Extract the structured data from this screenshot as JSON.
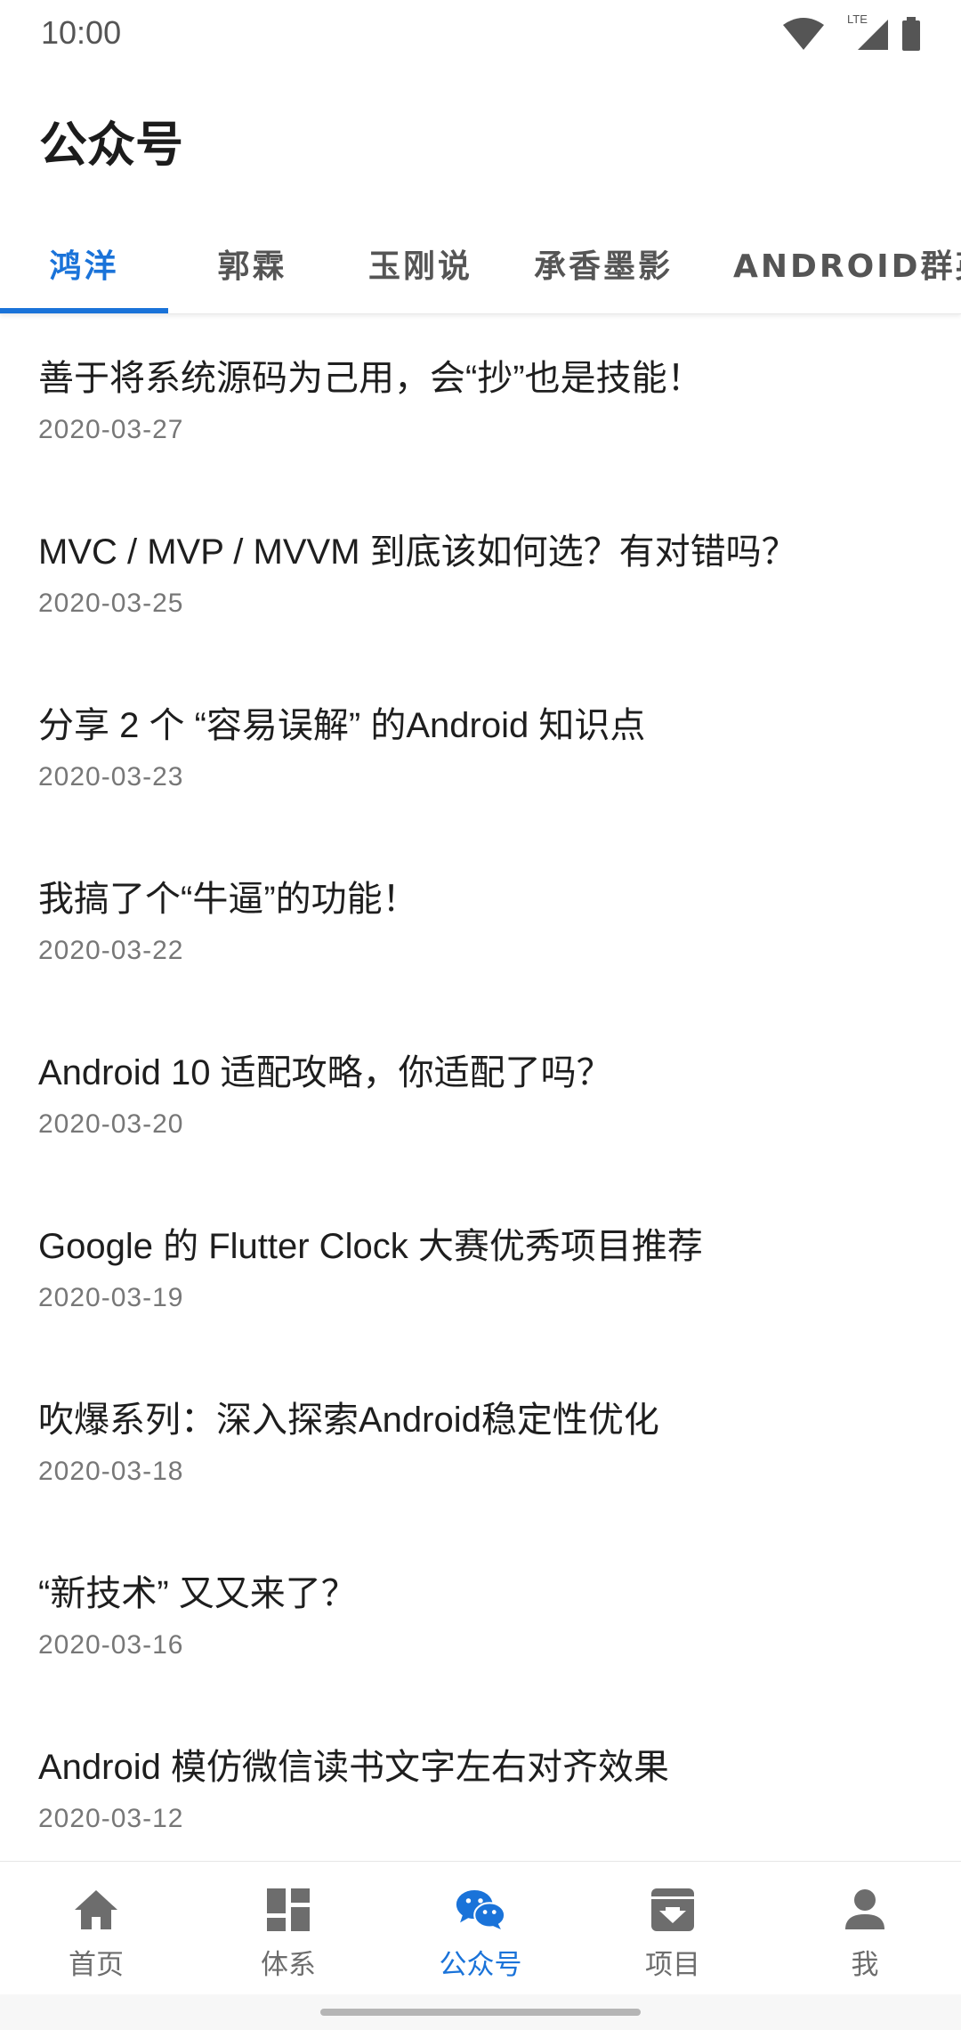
{
  "status_bar": {
    "time": "10:00",
    "network_label": "LTE"
  },
  "app": {
    "title": "公众号"
  },
  "tabs": [
    {
      "label": "鸿洋",
      "active": true
    },
    {
      "label": "郭霖",
      "active": false
    },
    {
      "label": "玉刚说",
      "active": false
    },
    {
      "label": "承香墨影",
      "active": false
    },
    {
      "label": "ANDROID群英",
      "active": false
    }
  ],
  "articles": [
    {
      "title": "善于将系统源码为己用，会“抄”也是技能！",
      "date": "2020-03-27"
    },
    {
      "title": "MVC / MVP / MVVM 到底该如何选？有对错吗？",
      "date": "2020-03-25"
    },
    {
      "title": "分享 2 个 “容易误解” 的Android 知识点",
      "date": "2020-03-23"
    },
    {
      "title": "我搞了个“牛逼”的功能！",
      "date": "2020-03-22"
    },
    {
      "title": "Android 10 适配攻略，你适配了吗？",
      "date": "2020-03-20"
    },
    {
      "title": "Google 的 Flutter Clock 大赛优秀项目推荐",
      "date": "2020-03-19"
    },
    {
      "title": "吹爆系列：深入探索Android稳定性优化",
      "date": "2020-03-18"
    },
    {
      "title": "“新技术” 又又来了？",
      "date": "2020-03-16"
    },
    {
      "title": "Android 模仿微信读书文字左右对齐效果",
      "date": "2020-03-12"
    }
  ],
  "bottom_nav": [
    {
      "label": "首页",
      "icon": "home-icon",
      "active": false
    },
    {
      "label": "体系",
      "icon": "dashboard-icon",
      "active": false
    },
    {
      "label": "公众号",
      "icon": "wechat-icon",
      "active": true
    },
    {
      "label": "项目",
      "icon": "archive-icon",
      "active": false
    },
    {
      "label": "我",
      "icon": "person-icon",
      "active": false
    }
  ],
  "colors": {
    "accent": "#1a73d9",
    "inactive": "#6d6d6d",
    "text": "#1e1e1e",
    "date": "#777777"
  }
}
